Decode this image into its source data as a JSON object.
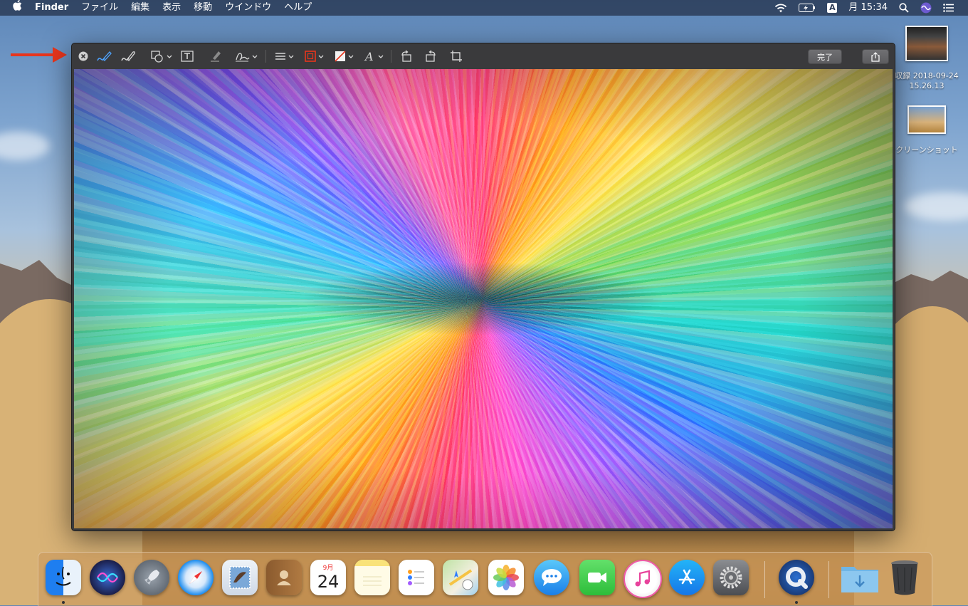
{
  "menubar": {
    "apple_icon": "apple-icon",
    "app_name": "Finder",
    "menus": [
      "ファイル",
      "編集",
      "表示",
      "移動",
      "ウインドウ",
      "ヘルプ"
    ],
    "input_source": "A",
    "clock": "月 15:34"
  },
  "desktop": {
    "icon1_label_line1": "収録 2018-09-24",
    "icon1_label_line2": "15.26.13",
    "icon2_label": "クリーンショット"
  },
  "annotation": {
    "arrow_color": "#e8351c"
  },
  "markup_window": {
    "done_label": "完了",
    "tools": [
      "close-icon",
      "sketch-icon",
      "draw-icon",
      "shapes-icon",
      "text-box-icon",
      "highlight-icon",
      "signature-icon",
      "line-style-icon",
      "border-color-icon",
      "fill-color-icon",
      "text-style-icon",
      "rotate-left-icon",
      "rotate-right-icon",
      "crop-icon",
      "share-icon"
    ]
  },
  "dock": {
    "calendar_month": "9月",
    "calendar_day": "24",
    "apps": [
      "Finder",
      "Siri",
      "Launchpad",
      "Safari",
      "Mail",
      "Contacts",
      "Calendar",
      "Notes",
      "Reminders",
      "Maps",
      "Photos",
      "Messages",
      "FaceTime",
      "iTunes",
      "App Store",
      "System Preferences",
      "QuickTime Player",
      "Downloads",
      "Trash"
    ]
  }
}
